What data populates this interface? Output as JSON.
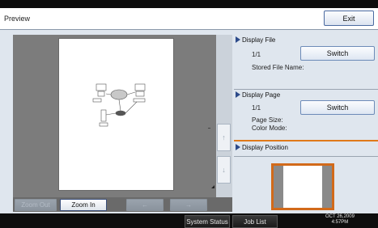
{
  "title": "Preview",
  "exit_label": "Exit",
  "preview": {
    "zoom_out_label": "Zoom Out",
    "zoom_in_label": "Zoom In",
    "prev_arrow": "←",
    "next_arrow": "→",
    "scroll_up_arrow": "↑",
    "scroll_down_arrow": "↓"
  },
  "display_file": {
    "heading": "Display File",
    "count": "1/1",
    "switch_label": "Switch",
    "stored_file_name_label": "Stored File Name:"
  },
  "display_page": {
    "heading": "Display Page",
    "count": "1/1",
    "switch_label": "Switch",
    "page_size_label": "Page Size:",
    "color_mode_label": "Color Mode:"
  },
  "display_position": {
    "heading": "Display Position"
  },
  "status_bar": {
    "system_status_label": "System Status",
    "job_list_label": "Job List",
    "date": "OCT  26,2009",
    "time": "4:57PM"
  },
  "colors": {
    "accent_blue": "#2c4a8a",
    "highlight_orange": "#e07a1a",
    "panel_bg": "#dfe6ee"
  }
}
